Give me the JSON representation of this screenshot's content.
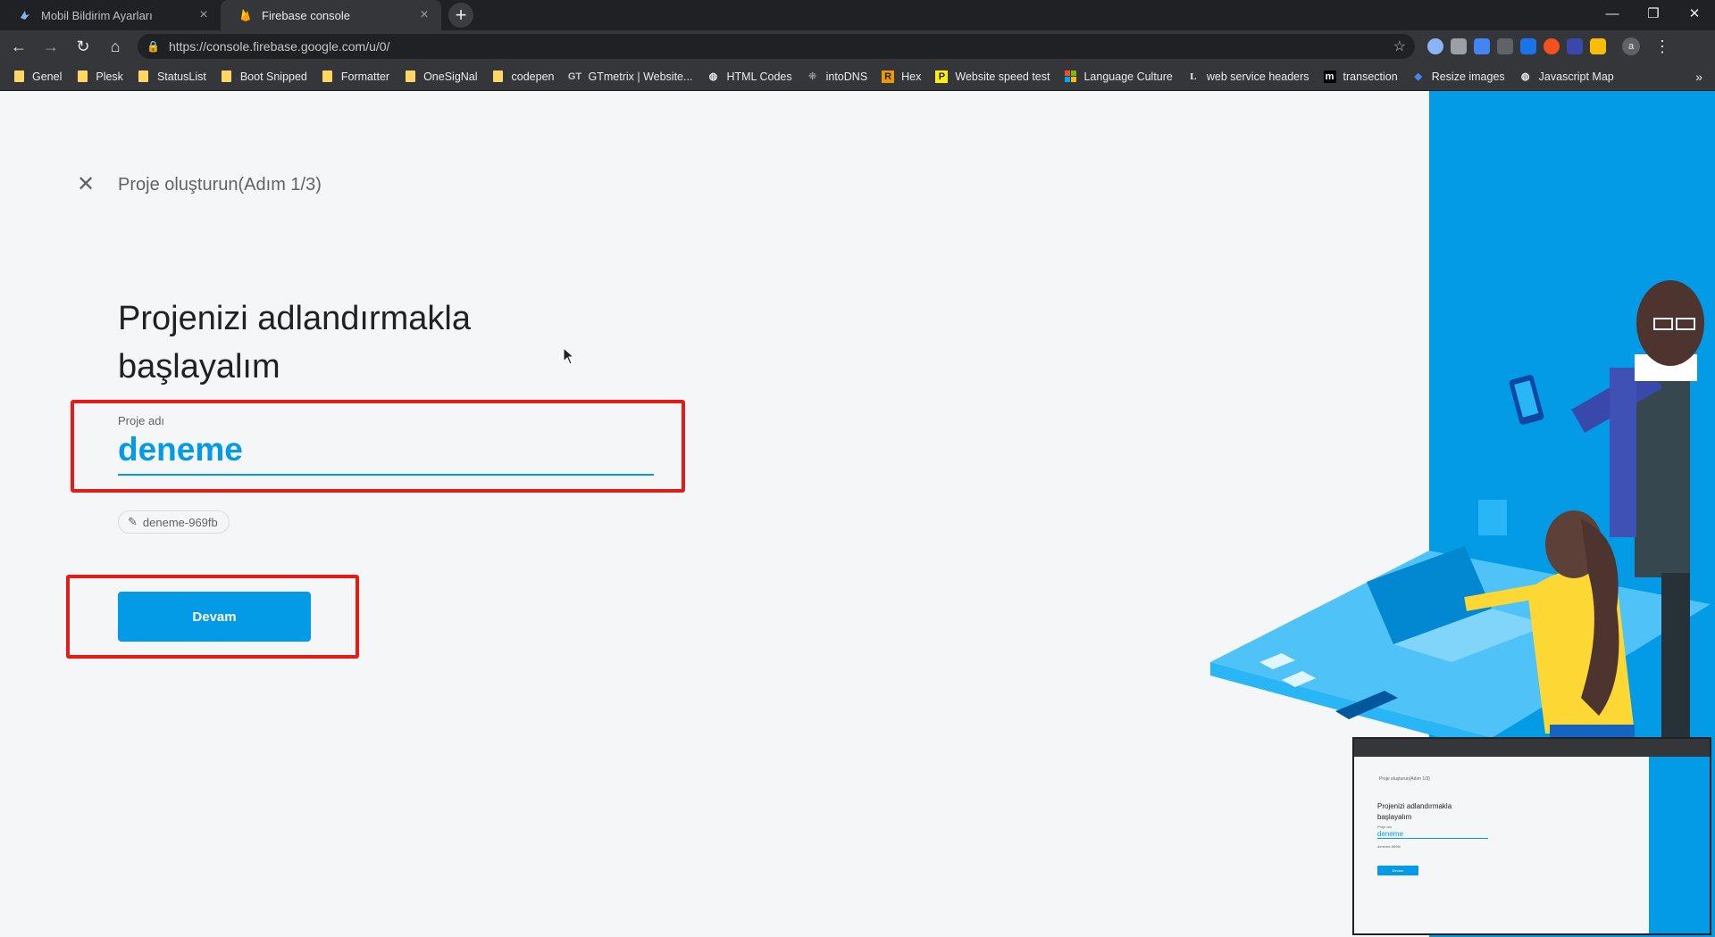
{
  "browser": {
    "tabs": [
      {
        "title": "Mobil Bildirim Ayarları",
        "active": false,
        "favicon": "bird-icon"
      },
      {
        "title": "Firebase console",
        "active": true,
        "favicon": "firebase-flame-icon"
      }
    ],
    "address_bar": {
      "url": "https://console.firebase.google.com/u/0/"
    },
    "profile_initial": "a",
    "bookmarks": [
      {
        "label": "Genel",
        "icon": "folder-icon"
      },
      {
        "label": "Plesk",
        "icon": "folder-icon"
      },
      {
        "label": "StatusList",
        "icon": "folder-icon"
      },
      {
        "label": "Boot Snipped",
        "icon": "folder-icon"
      },
      {
        "label": "Formatter",
        "icon": "folder-icon"
      },
      {
        "label": "OneSigNal",
        "icon": "folder-icon"
      },
      {
        "label": "codepen",
        "icon": "folder-icon"
      },
      {
        "label": "GTmetrix | Website...",
        "icon": "gtmetrix-icon"
      },
      {
        "label": "HTML Codes",
        "icon": "globe-icon"
      },
      {
        "label": "intoDNS",
        "icon": "dns-icon"
      },
      {
        "label": "Hex",
        "icon": "hex-icon"
      },
      {
        "label": "Website speed test",
        "icon": "pingdom-icon"
      },
      {
        "label": "Language Culture",
        "icon": "windows-icon"
      },
      {
        "label": "web service headers",
        "icon": "l-icon"
      },
      {
        "label": "transection",
        "icon": "m-icon"
      },
      {
        "label": "Resize images",
        "icon": "resize-icon"
      },
      {
        "label": "Javascript Map",
        "icon": "globe-icon"
      }
    ]
  },
  "page": {
    "step_title": "Proje oluşturun(Adım 1/3)",
    "heading_line1": "Projenizi adlandırmakla",
    "heading_line2": "başlayalım",
    "project_name_label": "Proje adı",
    "project_name_value": "deneme",
    "project_id": "deneme-969fb",
    "continue_label": "Devam"
  },
  "colors": {
    "accent": "#039be5",
    "highlight": "#e41b17",
    "panel": "#039be5"
  }
}
